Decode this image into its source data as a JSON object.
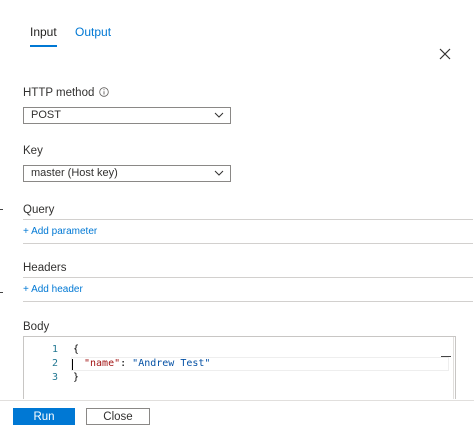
{
  "tabs": [
    {
      "label": "Input",
      "active": true
    },
    {
      "label": "Output",
      "active": false
    }
  ],
  "http_method": {
    "label": "HTTP method",
    "value": "POST"
  },
  "key": {
    "label": "Key",
    "value": "master (Host key)"
  },
  "query": {
    "label": "Query",
    "add_label": "+ Add parameter"
  },
  "headers": {
    "label": "Headers",
    "add_label": "+ Add header"
  },
  "body": {
    "label": "Body",
    "lines": [
      {
        "num": "1",
        "text": "{"
      },
      {
        "num": "2",
        "key": "\"name\"",
        "sep": ": ",
        "value": "\"Andrew Test\""
      },
      {
        "num": "3",
        "text": "}"
      }
    ]
  },
  "footer": {
    "run_label": "Run",
    "close_label": "Close"
  },
  "colors": {
    "accent": "#0078d4",
    "json_key": "#a31515",
    "json_string": "#0451a5",
    "line_number": "#237893"
  },
  "icons": {
    "close": "close-icon",
    "info": "info-icon",
    "dropdown": "chevron-down-icon"
  }
}
